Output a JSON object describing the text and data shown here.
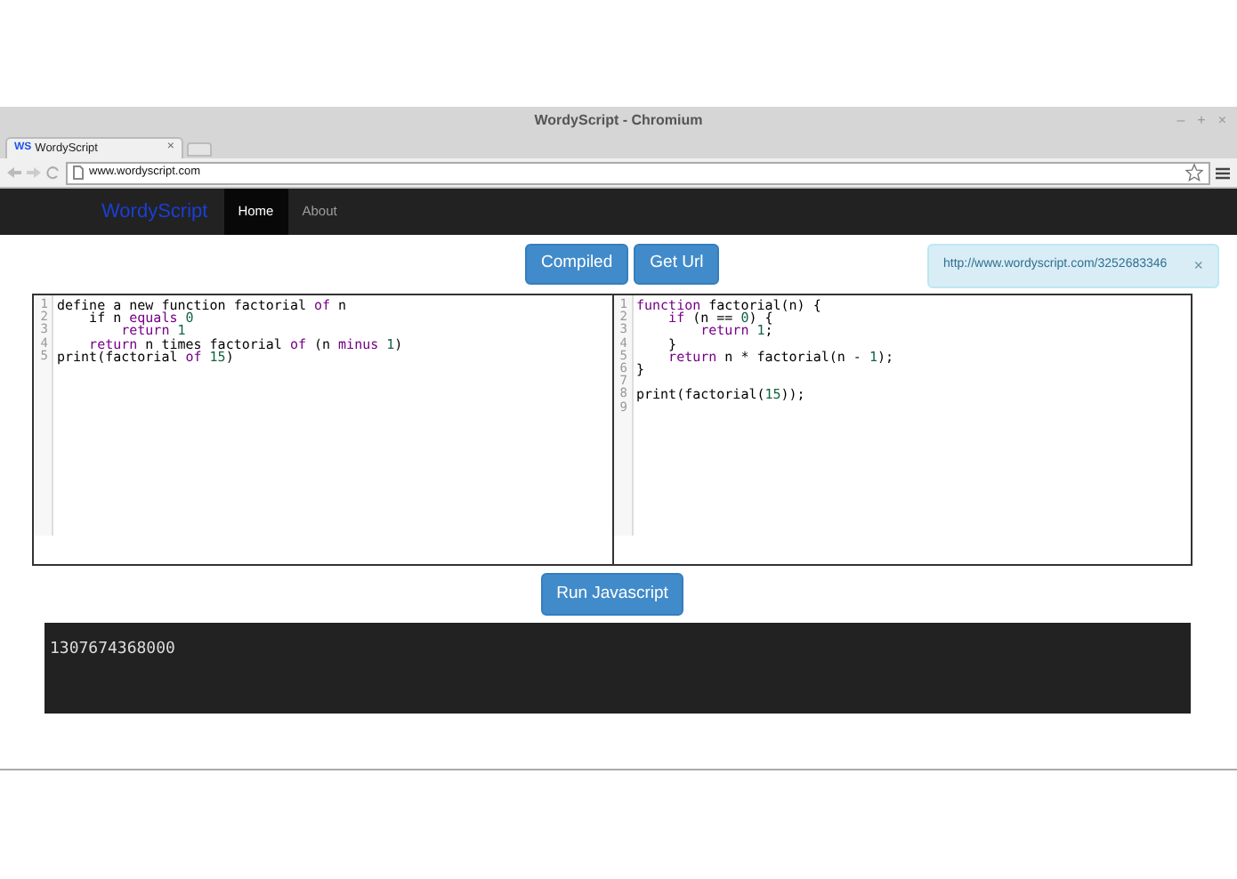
{
  "window": {
    "title": "WordyScript - Chromium",
    "controls": [
      "–",
      "+",
      "×"
    ]
  },
  "tab": {
    "favicon": "WS",
    "title": "WordyScript",
    "close": "×"
  },
  "address": {
    "url": "www.wordyscript.com"
  },
  "navbar": {
    "brand": "WordyScript",
    "links": [
      {
        "label": "Home",
        "selected": true
      },
      {
        "label": "About",
        "selected": false
      }
    ]
  },
  "toolbar": {
    "buttons": [
      "Compiled",
      "Get Url"
    ]
  },
  "alert": {
    "text": "http://www.wordyscript.com/3252683346",
    "close": "×"
  },
  "editors": [
    {
      "lines": [
        {
          "number": "1",
          "tokens": [
            {
              "text": "define a new function factorial ",
              "kind": "plain"
            },
            {
              "text": "of",
              "kind": "keyword"
            },
            {
              "text": " n",
              "kind": "plain"
            }
          ]
        },
        {
          "number": "2",
          "tokens": [
            {
              "text": "    if n ",
              "kind": "plain"
            },
            {
              "text": "equals",
              "kind": "keyword"
            },
            {
              "text": " 0",
              "kind": "number"
            }
          ]
        },
        {
          "number": "3",
          "tokens": [
            {
              "text": "        return",
              "kind": "keyword"
            },
            {
              "text": " 1",
              "kind": "number"
            }
          ]
        },
        {
          "number": "4",
          "tokens": [
            {
              "text": "    return",
              "kind": "keyword"
            },
            {
              "text": " n times factorial ",
              "kind": "plain"
            },
            {
              "text": "of",
              "kind": "keyword"
            },
            {
              "text": " (n ",
              "kind": "plain"
            },
            {
              "text": "minus",
              "kind": "keyword"
            },
            {
              "text": " 1",
              "kind": "number"
            },
            {
              "text": ")",
              "kind": "plain"
            }
          ]
        },
        {
          "number": "5",
          "tokens": [
            {
              "text": "print(factorial ",
              "kind": "plain"
            },
            {
              "text": "of",
              "kind": "keyword"
            },
            {
              "text": " 15",
              "kind": "number"
            },
            {
              "text": ")",
              "kind": "plain"
            }
          ]
        }
      ]
    },
    {
      "lines": [
        {
          "number": "1",
          "tokens": [
            {
              "text": "function",
              "kind": "keyword"
            },
            {
              "text": " factorial(n) {",
              "kind": "plain"
            }
          ]
        },
        {
          "number": "2",
          "tokens": [
            {
              "text": "    if",
              "kind": "keyword"
            },
            {
              "text": " (n == ",
              "kind": "plain"
            },
            {
              "text": "0",
              "kind": "number"
            },
            {
              "text": ") {",
              "kind": "plain"
            }
          ]
        },
        {
          "number": "3",
          "tokens": [
            {
              "text": "        return",
              "kind": "keyword"
            },
            {
              "text": " 1",
              "kind": "number"
            },
            {
              "text": ";",
              "kind": "plain"
            }
          ]
        },
        {
          "number": "4",
          "tokens": [
            {
              "text": "    }",
              "kind": "plain"
            }
          ]
        },
        {
          "number": "5",
          "tokens": [
            {
              "text": "    return",
              "kind": "keyword"
            },
            {
              "text": " n * factorial(n - ",
              "kind": "plain"
            },
            {
              "text": "1",
              "kind": "number"
            },
            {
              "text": ");",
              "kind": "plain"
            }
          ]
        },
        {
          "number": "6",
          "tokens": [
            {
              "text": "}",
              "kind": "plain"
            }
          ]
        },
        {
          "number": "7"
        },
        {
          "number": "8",
          "tokens": [
            {
              "text": "print(factorial(",
              "kind": "plain"
            },
            {
              "text": "15",
              "kind": "number"
            },
            {
              "text": "));",
              "kind": "plain"
            }
          ]
        },
        {
          "number": "9"
        }
      ]
    }
  ],
  "run_button": "Run Javascript",
  "output": "1307674368000"
}
